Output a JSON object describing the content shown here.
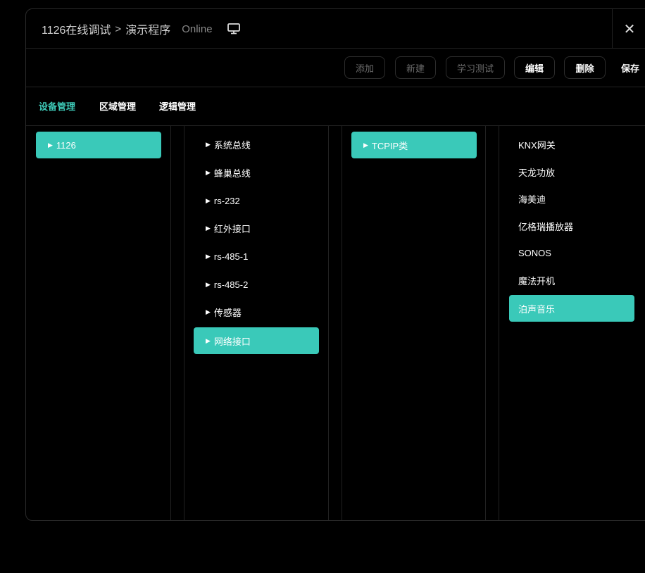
{
  "header": {
    "breadcrumb_root": "1126在线调试",
    "separator": ">",
    "page": "演示程序",
    "status": "Online",
    "monitor_icon": "monitor-icon",
    "close_label": "✕"
  },
  "toolbar": {
    "add": "添加",
    "new": "新建",
    "learn_test": "学习测试",
    "edit": "编辑",
    "delete": "删除",
    "save": "保存"
  },
  "tabs": [
    "设备管理",
    "区域管理",
    "逻辑管理"
  ],
  "columns": {
    "col1": [
      {
        "label": "1126",
        "selected": true
      }
    ],
    "col2": [
      {
        "label": "系统总线",
        "selected": false
      },
      {
        "label": "蜂巢总线",
        "selected": false
      },
      {
        "label": "rs-232",
        "selected": false
      },
      {
        "label": "红外接口",
        "selected": false
      },
      {
        "label": "rs-485-1",
        "selected": false
      },
      {
        "label": "rs-485-2",
        "selected": false
      },
      {
        "label": "传感器",
        "selected": false
      },
      {
        "label": "网络接口",
        "selected": true
      }
    ],
    "col3": [
      {
        "label": "TCPIP类",
        "selected": true
      }
    ],
    "col4": [
      {
        "label": "KNX网关",
        "selected": false
      },
      {
        "label": "天龙功放",
        "selected": false
      },
      {
        "label": "海美迪",
        "selected": false
      },
      {
        "label": "亿格瑞播放器",
        "selected": false
      },
      {
        "label": "SONOS",
        "selected": false
      },
      {
        "label": "魔法开机",
        "selected": false
      },
      {
        "label": "泊声音乐",
        "selected": true
      }
    ]
  },
  "colors": {
    "accent": "#3ac9b9",
    "background": "#000000"
  }
}
